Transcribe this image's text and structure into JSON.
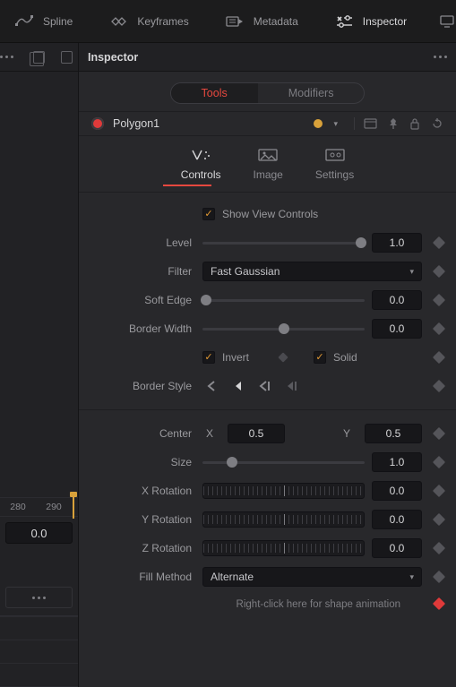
{
  "top_tabs": {
    "spline": "Spline",
    "keyframes": "Keyframes",
    "metadata": "Metadata",
    "inspector": "Inspector"
  },
  "panel_title": "Inspector",
  "segmented": {
    "tools": "Tools",
    "modifiers": "Modifiers"
  },
  "node": {
    "name": "Polygon1"
  },
  "subtabs": {
    "controls": "Controls",
    "image": "Image",
    "settings": "Settings"
  },
  "controls": {
    "show_view_controls": {
      "label": "Show View Controls",
      "checked": true
    },
    "level": {
      "label": "Level",
      "value": "1.0",
      "slider_pos": 0.98
    },
    "filter": {
      "label": "Filter",
      "value": "Fast Gaussian"
    },
    "soft_edge": {
      "label": "Soft Edge",
      "value": "0.0",
      "slider_pos": 0.02
    },
    "border_width": {
      "label": "Border Width",
      "value": "0.0",
      "slider_pos": 0.5
    },
    "invert": {
      "label": "Invert",
      "checked": true
    },
    "solid": {
      "label": "Solid",
      "checked": true
    },
    "border_style": {
      "label": "Border Style"
    },
    "center": {
      "label": "Center",
      "x_label": "X",
      "x": "0.5",
      "y_label": "Y",
      "y": "0.5"
    },
    "size": {
      "label": "Size",
      "value": "1.0",
      "slider_pos": 0.18
    },
    "x_rotation": {
      "label": "X Rotation",
      "value": "0.0"
    },
    "y_rotation": {
      "label": "Y Rotation",
      "value": "0.0"
    },
    "z_rotation": {
      "label": "Z Rotation",
      "value": "0.0"
    },
    "fill_method": {
      "label": "Fill Method",
      "value": "Alternate"
    },
    "hint": "Right-click here for shape animation"
  },
  "timeline": {
    "mark1": "280",
    "mark2": "290",
    "readout": "0.0"
  }
}
